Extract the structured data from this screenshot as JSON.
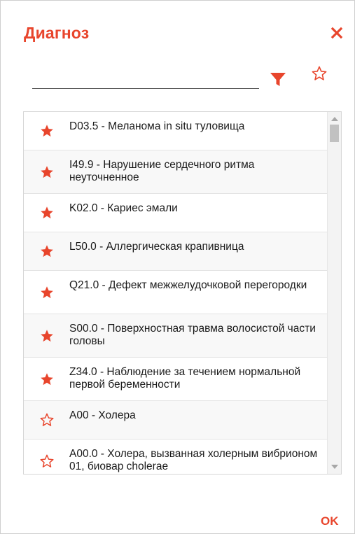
{
  "dialog": {
    "title": "Диагноз",
    "ok_label": "OK"
  },
  "search": {
    "value": "",
    "placeholder": ""
  },
  "colors": {
    "accent": "#e8452c"
  },
  "icons": {
    "close": "close-icon",
    "filter": "filter-icon",
    "favorites_toggle": "star-outline-icon",
    "favorite": "star-filled-icon",
    "not_favorite": "star-outline-icon"
  },
  "diagnoses": [
    {
      "label": "D03.5 - Меланома in situ туловища",
      "favorite": true
    },
    {
      "label": "I49.9 - Нарушение сердечного ритма неуточненное",
      "favorite": true
    },
    {
      "label": "K02.0 - Кариес эмали",
      "favorite": true
    },
    {
      "label": "L50.0 - Аллергическая крапивница",
      "favorite": true
    },
    {
      "label": "Q21.0 - Дефект межжелудочковой перегородки",
      "favorite": true
    },
    {
      "label": "S00.0 - Поверхностная травма волосистой части головы",
      "favorite": true
    },
    {
      "label": "Z34.0 - Наблюдение за течением нормальной первой беременности",
      "favorite": true
    },
    {
      "label": "A00 - Холера",
      "favorite": false
    },
    {
      "label": "A00.0 - Холера, вызванная холерным вибрионом 01, биовар cholerae",
      "favorite": false
    }
  ]
}
